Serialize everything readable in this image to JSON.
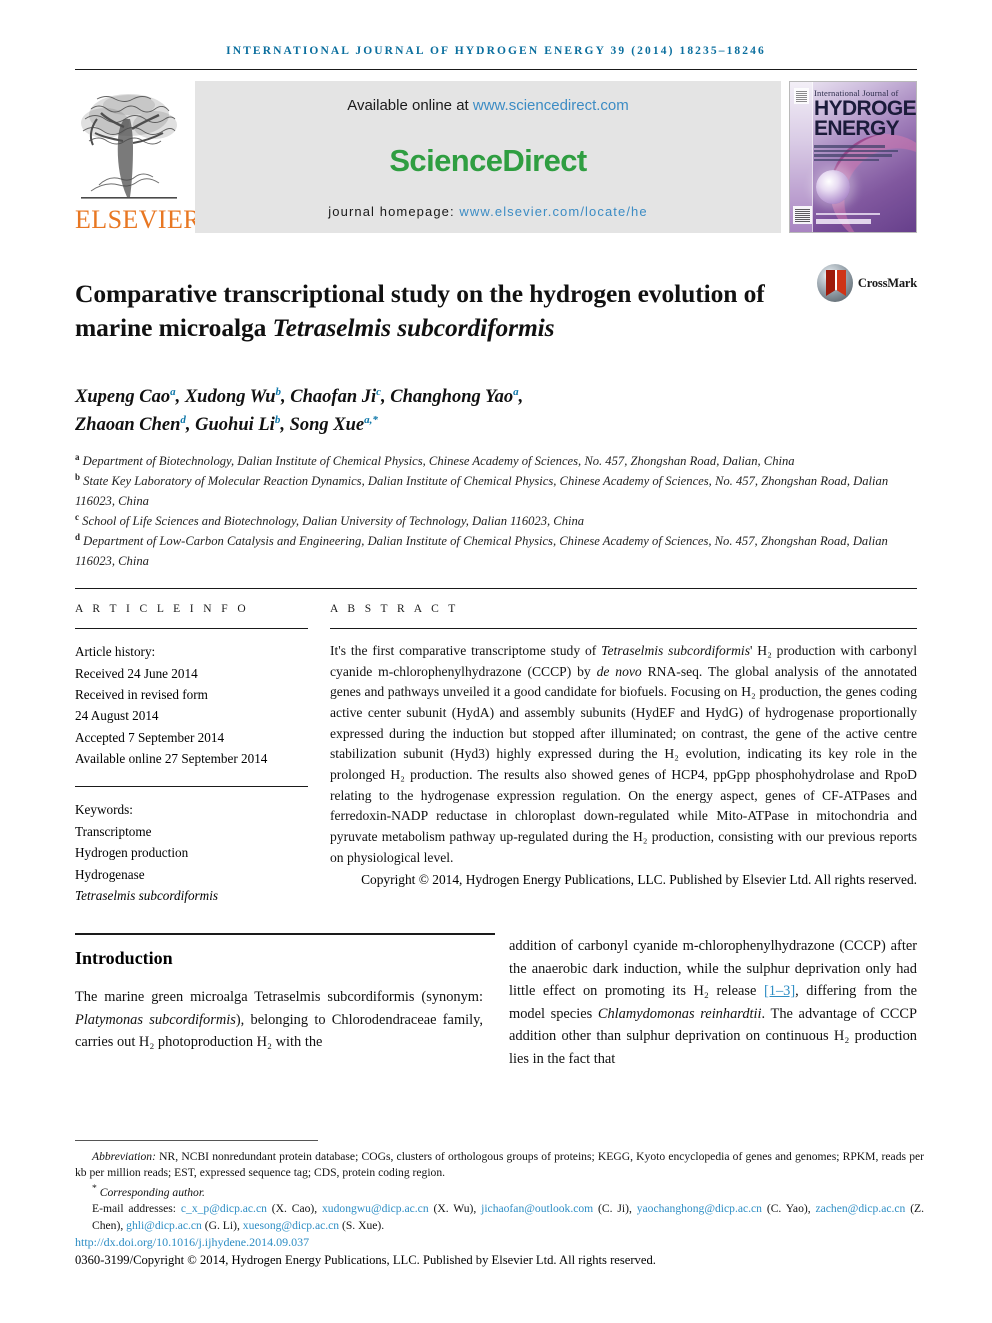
{
  "running_head": "International Journal of Hydrogen Energy 39 (2014) 18235–18246",
  "masthead": {
    "elsevier_wordmark": "ELSEVIER",
    "available_prefix": "Available online at ",
    "available_url": "www.sciencedirect.com",
    "sciencedirect_logo": "ScienceDirect",
    "homepage_prefix": "journal homepage: ",
    "homepage_url": "www.elsevier.com/locate/he",
    "cover": {
      "line1": "International Journal of",
      "line2": "HYDROGEN",
      "line3": "ENERGY"
    }
  },
  "article": {
    "title_part1": "Comparative transcriptional study on the hydrogen evolution of marine microalga ",
    "title_italic": "Tetraselmis subcordiformis",
    "crossmark_label": "CrossMark",
    "authors_line1": "Xupeng Cao",
    "authors": [
      {
        "name": "Xupeng Cao",
        "sup": "a"
      },
      {
        "name": "Xudong Wu",
        "sup": "b"
      },
      {
        "name": "Chaofan Ji",
        "sup": "c"
      },
      {
        "name": "Changhong Yao",
        "sup": "a"
      },
      {
        "name": "Zhaoan Chen",
        "sup": "d"
      },
      {
        "name": "Guohui Li",
        "sup": "b"
      },
      {
        "name": "Song Xue",
        "sup": "a,*"
      }
    ],
    "affiliations": [
      {
        "sup": "a",
        "text": "Department of Biotechnology, Dalian Institute of Chemical Physics, Chinese Academy of Sciences, No. 457, Zhongshan Road, Dalian, China"
      },
      {
        "sup": "b",
        "text": "State Key Laboratory of Molecular Reaction Dynamics, Dalian Institute of Chemical Physics, Chinese Academy of Sciences, No. 457, Zhongshan Road, Dalian 116023, China"
      },
      {
        "sup": "c",
        "text": "School of Life Sciences and Biotechnology, Dalian University of Technology, Dalian 116023, China"
      },
      {
        "sup": "d",
        "text": "Department of Low-Carbon Catalysis and Engineering, Dalian Institute of Chemical Physics, Chinese Academy of Sciences, No. 457, Zhongshan Road, Dalian 116023, China"
      }
    ]
  },
  "info": {
    "heading": "A R T I C L E   I N F O",
    "history_label": "Article history:",
    "history": [
      "Received 24 June 2014",
      "Received in revised form",
      "24 August 2014",
      "Accepted 7 September 2014",
      "Available online 27 September 2014"
    ],
    "keywords_label": "Keywords:",
    "keywords": [
      "Transcriptome",
      "Hydrogen production",
      "Hydrogenase",
      "Tetraselmis subcordiformis"
    ]
  },
  "abstract": {
    "heading": "A B S T R A C T",
    "text_p1": "It's the first comparative transcriptome study of ",
    "text_italic1": "Tetraselmis subcordiformis",
    "text_p2": "' H₂ production with carbonyl cyanide m-chlorophenylhydrazone (CCCP) by ",
    "text_italic2": "de novo",
    "text_p3": " RNA-seq. The global analysis of the annotated genes and pathways unveiled it a good candidate for biofuels. Focusing on H₂ production, the genes coding active center subunit (HydA) and assembly subunits (HydEF and HydG) of hydrogenase proportionally expressed during the induction but stopped after illuminated; on contrast, the gene of the active centre stabilization subunit (Hyd3) highly expressed during the H₂ evolution, indicating its key role in the prolonged H₂ production. The results also showed genes of HCP4, ppGpp phosphohydrolase and RpoD relating to the hydrogenase expression regulation. On the energy aspect, genes of CF-ATPases and ferredoxin-NADP reductase in chloroplast down-regulated while Mito-ATPase in mitochondria and pyruvate metabolism pathway up-regulated during the H₂ production, consisting with our previous reports on physiological level.",
    "copyright": "Copyright © 2014, Hydrogen Energy Publications, LLC. Published by Elsevier Ltd. All rights reserved."
  },
  "introduction": {
    "heading": "Introduction",
    "left_p1": "The marine green microalga Tetraselmis subcordiformis (synonym: ",
    "left_italic": "Platymonas subcordiformis",
    "left_p2": "), belonging to Chlorodendraceae family, carries out H₂ photoproduction H₂ with the",
    "right_p1": "addition of carbonyl cyanide m-chlorophenylhydrazone (CCCP) after the anaerobic dark induction, while the sulphur deprivation only had little effect on promoting its H₂ release ",
    "right_ref": "[1–3]",
    "right_p2": ", differing from the model species ",
    "right_italic": "Chlamydomonas reinhardtii",
    "right_p3": ". The advantage of CCCP addition other than sulphur deprivation on continuous H₂ production lies in the fact that"
  },
  "footnotes": {
    "abbrev_label": "Abbreviation:",
    "abbrev_text": " NR, NCBI nonredundant protein database; COGs, clusters of orthologous groups of proteins; KEGG, Kyoto encyclopedia of genes and genomes; RPKM, reads per kb per million reads; EST, expressed sequence tag; CDS, protein coding region.",
    "corresponding": "Corresponding author.",
    "email_label": "E-mail addresses:",
    "emails": [
      {
        "addr": "c_x_p@dicp.ac.cn",
        "who": "(X. Cao)"
      },
      {
        "addr": "xudongwu@dicp.ac.cn",
        "who": "(X. Wu)"
      },
      {
        "addr": "jichaofan@outlook.com",
        "who": "(C. Ji)"
      },
      {
        "addr": "yaochanghong@dicp.ac.cn",
        "who": "(C. Yao)"
      },
      {
        "addr": "zachen@dicp.ac.cn",
        "who": "(Z. Chen)"
      },
      {
        "addr": "ghli@dicp.ac.cn",
        "who": "(G. Li)"
      },
      {
        "addr": "xuesong@dicp.ac.cn",
        "who": "(S. Xue)"
      }
    ],
    "doi": "http://dx.doi.org/10.1016/j.ijhydene.2014.09.037",
    "issn_line": "0360-3199/Copyright © 2014, Hydrogen Energy Publications, LLC. Published by Elsevier Ltd. All rights reserved."
  },
  "colors": {
    "running_head": "#0a6e9e",
    "link": "#2d8dc4",
    "elsevier_orange": "#e87722",
    "sciencedirect_green": "#2f9e41"
  }
}
